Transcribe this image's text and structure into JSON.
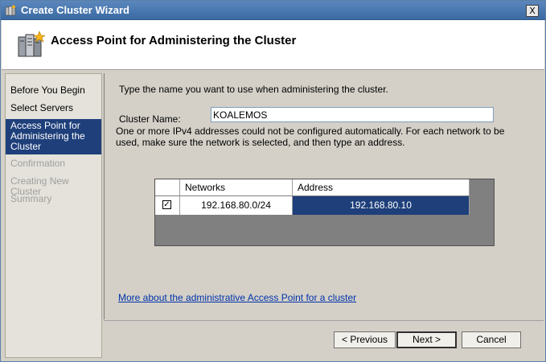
{
  "window": {
    "title": "Create Cluster Wizard",
    "close_label": "X"
  },
  "header": {
    "title": "Access Point for Administering the Cluster",
    "icon": "cluster-server-icon"
  },
  "nav": {
    "items": [
      {
        "label": "Before You Begin",
        "state": "normal"
      },
      {
        "label": "Select Servers",
        "state": "normal"
      },
      {
        "label": "Access Point for Administering the Cluster",
        "state": "active"
      },
      {
        "label": "Confirmation",
        "state": "disabled"
      },
      {
        "label": "Creating New Cluster",
        "state": "disabled"
      },
      {
        "label": "Summary",
        "state": "disabled"
      }
    ]
  },
  "content": {
    "instruction": "Type the name you want to use when administering the cluster.",
    "cluster_name_label": "Cluster Name:",
    "cluster_name_value": "KOALEMOS",
    "warning": "One or more IPv4 addresses could not be configured automatically.  For each network to be used, make sure the network is selected, and then type an address.",
    "grid": {
      "columns": [
        "",
        "Networks",
        "Address"
      ],
      "rows": [
        {
          "checked": true,
          "network": "192.168.80.0/24",
          "address": "192.168.80.10"
        }
      ]
    },
    "more_link": "More about the administrative Access Point for a cluster"
  },
  "buttons": {
    "previous": "< Previous",
    "next": "Next >",
    "cancel": "Cancel"
  },
  "colors": {
    "accent": "#1e3f7a",
    "titlebar": "#3a6aa3",
    "link": "#0033aa"
  }
}
